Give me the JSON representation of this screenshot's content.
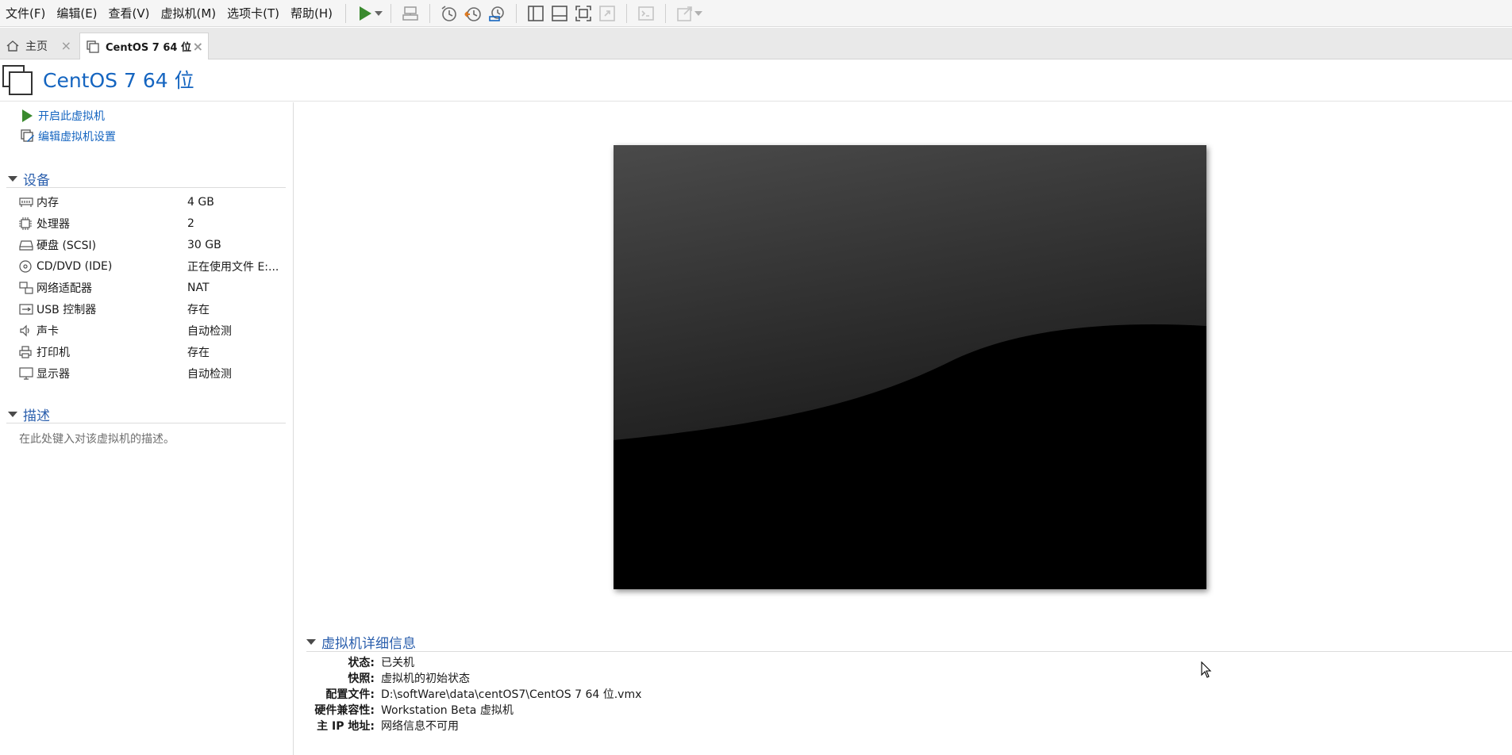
{
  "menu": {
    "items": [
      "文件(F)",
      "编辑(E)",
      "查看(V)",
      "虚拟机(M)",
      "选项卡(T)",
      "帮助(H)"
    ]
  },
  "toolbar": {
    "icons": [
      "play-icon",
      "dropdown-arrow-icon",
      "send-keys-icon",
      "snapshot-icon",
      "revert-snapshot-icon",
      "snapshot-manager-icon",
      "library-view-icon",
      "thumbnail-view-icon",
      "fullscreen-icon",
      "unity-icon",
      "console-icon",
      "stretch-icon"
    ]
  },
  "tabs": [
    {
      "label": "主页"
    },
    {
      "label": "CentOS 7 64 位"
    }
  ],
  "page": {
    "title": "CentOS 7 64 位"
  },
  "actions": {
    "power_on": "开启此虚拟机",
    "edit_settings": "编辑虚拟机设置"
  },
  "devices": {
    "header": "设备",
    "items": [
      {
        "name": "内存",
        "value": "4 GB",
        "icon": "memory-icon"
      },
      {
        "name": "处理器",
        "value": "2",
        "icon": "processor-icon"
      },
      {
        "name": "硬盘 (SCSI)",
        "value": "30 GB",
        "icon": "hard-disk-icon"
      },
      {
        "name": "CD/DVD (IDE)",
        "value": "正在使用文件 E:...",
        "icon": "cd-dvd-icon"
      },
      {
        "name": "网络适配器",
        "value": "NAT",
        "icon": "network-adapter-icon"
      },
      {
        "name": "USB 控制器",
        "value": "存在",
        "icon": "usb-icon"
      },
      {
        "name": "声卡",
        "value": "自动检测",
        "icon": "sound-card-icon"
      },
      {
        "name": "打印机",
        "value": "存在",
        "icon": "printer-icon"
      },
      {
        "name": "显示器",
        "value": "自动检测",
        "icon": "display-icon"
      }
    ]
  },
  "description": {
    "header": "描述",
    "placeholder": "在此处键入对该虚拟机的描述。"
  },
  "details": {
    "header": "虚拟机详细信息",
    "rows": [
      {
        "key": "状态:",
        "value": "已关机"
      },
      {
        "key": "快照:",
        "value": "虚拟机的初始状态"
      },
      {
        "key": "配置文件:",
        "value": "D:\\softWare\\data\\centOS7\\CentOS 7 64 位.vmx"
      },
      {
        "key": "硬件兼容性:",
        "value": "Workstation Beta 虚拟机"
      },
      {
        "key": "主 IP 地址:",
        "value": "网络信息不可用"
      }
    ]
  },
  "colors": {
    "accent": "#1565c0",
    "section": "#2b5fad",
    "play_green": "#3a8a2e"
  }
}
